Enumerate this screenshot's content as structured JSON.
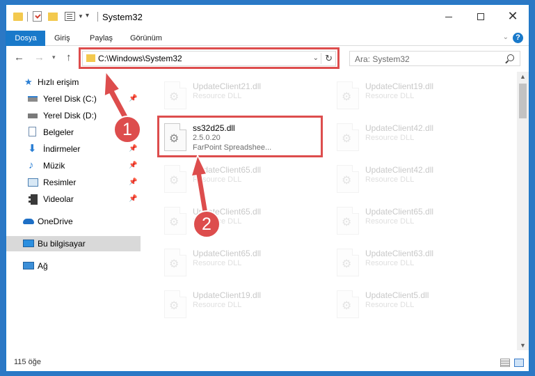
{
  "window": {
    "title": "System32",
    "min_label": "",
    "max_label": "",
    "close_label": "✕"
  },
  "ribbon": {
    "tabs": [
      "Dosya",
      "Giriş",
      "Paylaş",
      "Görünüm"
    ],
    "help": "?"
  },
  "nav": {
    "address": "C:\\Windows\\System32",
    "search_placeholder": "Ara: System32"
  },
  "sidebar": {
    "quick_access": "Hızlı erişim",
    "items": [
      {
        "label": "Yerel Disk (C:)",
        "icon": "drive-icon",
        "pinned": true
      },
      {
        "label": "Yerel Disk (D:)",
        "icon": "drive-icon",
        "pinned": false
      },
      {
        "label": "Belgeler",
        "icon": "documents-icon",
        "pinned": true
      },
      {
        "label": "İndirmeler",
        "icon": "downloads-icon",
        "pinned": true
      },
      {
        "label": "Müzik",
        "icon": "music-icon",
        "pinned": true
      },
      {
        "label": "Resimler",
        "icon": "pictures-icon",
        "pinned": true
      },
      {
        "label": "Videolar",
        "icon": "videos-icon",
        "pinned": true
      }
    ],
    "onedrive": "OneDrive",
    "this_pc": "Bu bilgisayar",
    "network": "Ağ"
  },
  "files": {
    "highlighted": {
      "name": "ss32d25.dll",
      "version": "2.5.0.20",
      "description": "FarPoint Spreadshee..."
    },
    "left_column": [
      {
        "name": "UpdateClient21.dll",
        "type": "Resource DLL"
      },
      {
        "name": "UpdateClient65.dll",
        "type": "Resource DLL"
      },
      {
        "name": "UpdateClient65.dll",
        "type": "Resource DLL"
      },
      {
        "name": "UpdateClient65.dll",
        "type": "Resource DLL"
      },
      {
        "name": "UpdateClient19.dll",
        "type": "Resource DLL"
      }
    ],
    "right_column": [
      {
        "name": "UpdateClient19.dll",
        "type": "Resource DLL"
      },
      {
        "name": "UpdateClient42.dll",
        "type": "Resource DLL"
      },
      {
        "name": "UpdateClient42.dll",
        "type": "Resource DLL"
      },
      {
        "name": "UpdateClient65.dll",
        "type": "Resource DLL"
      },
      {
        "name": "UpdateClient63.dll",
        "type": "Resource DLL"
      },
      {
        "name": "UpdateClient5.dll",
        "type": "Resource DLL"
      }
    ]
  },
  "status": {
    "count": "115 öğe"
  },
  "annotations": {
    "step1": "1",
    "step2": "2",
    "color": "#dd4d4d"
  }
}
